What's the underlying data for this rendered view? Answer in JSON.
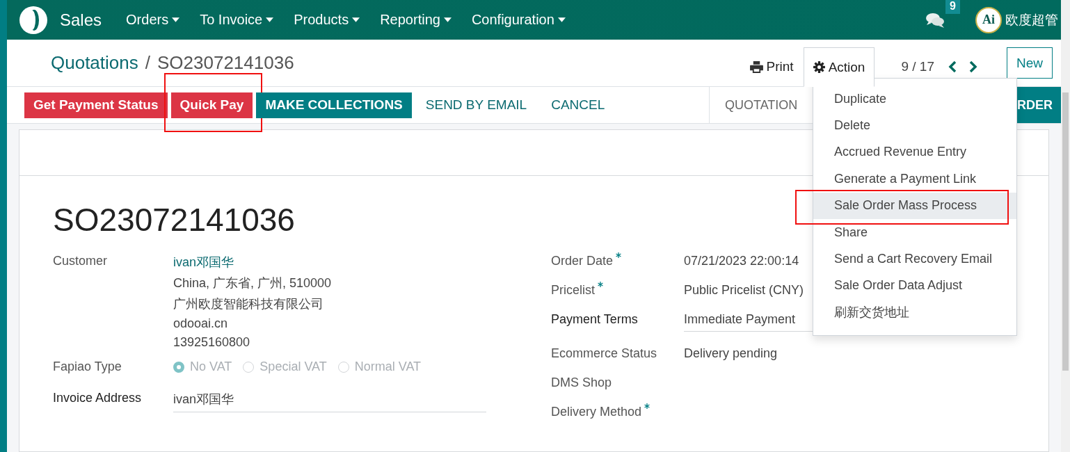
{
  "navbar": {
    "app": "Sales",
    "menus": [
      "Orders",
      "To Invoice",
      "Products",
      "Reporting",
      "Configuration"
    ],
    "messages_count": "9",
    "user": {
      "avatar_text": "Ai",
      "name": "欧度超管"
    }
  },
  "breadcrumb": {
    "parent": "Quotations",
    "separator": "/",
    "current": "SO23072141036"
  },
  "toolbar": {
    "print": "Print",
    "action": "Action",
    "action_open": true,
    "pager": "9 / 17",
    "new": "New"
  },
  "action_menu": [
    {
      "label": "Duplicate",
      "selected": false,
      "highlighted": false
    },
    {
      "label": "Delete",
      "selected": false,
      "highlighted": false
    },
    {
      "label": "Accrued Revenue Entry",
      "selected": false,
      "highlighted": false
    },
    {
      "label": "Generate a Payment Link",
      "selected": false,
      "highlighted": false
    },
    {
      "label": "Sale Order Mass Process",
      "selected": true,
      "highlighted": true
    },
    {
      "label": "Share",
      "selected": false,
      "highlighted": false
    },
    {
      "label": "Send a Cart Recovery Email",
      "selected": false,
      "highlighted": false
    },
    {
      "label": "Sale Order Data Adjust",
      "selected": false,
      "highlighted": false
    },
    {
      "label": "刷新交货地址",
      "selected": false,
      "highlighted": false
    }
  ],
  "buttons": [
    {
      "label": "Get Payment Status",
      "kind": "danger",
      "highlighted": false
    },
    {
      "label": "Quick Pay",
      "kind": "danger",
      "highlighted": true
    },
    {
      "label": "MAKE COLLECTIONS",
      "kind": "primary",
      "highlighted": false
    },
    {
      "label": "SEND BY EMAIL",
      "kind": "link",
      "highlighted": false
    },
    {
      "label": "CANCEL",
      "kind": "link",
      "highlighted": false
    }
  ],
  "statusbar": [
    {
      "label": "QUOTATION",
      "selected": false
    },
    {
      "label": "RDER",
      "selected": true
    }
  ],
  "form": {
    "title": "SO23072141036",
    "left": [
      {
        "label": "Customer",
        "kind": "partner",
        "value": "ivan邓国华",
        "lines": [
          "China, 广东省, 广州, 510000",
          "广州欧度智能科技有限公司",
          "odooai.cn",
          "13925160800"
        ]
      },
      {
        "label": "Fapiao Type",
        "kind": "radio",
        "options": [
          {
            "label": "No VAT",
            "selected": true
          },
          {
            "label": "Special VAT",
            "selected": false
          },
          {
            "label": "Normal VAT",
            "selected": false
          }
        ]
      },
      {
        "label": "Invoice Address",
        "kind": "input",
        "value": "ivan邓国华"
      }
    ],
    "right": [
      {
        "label": "Order Date",
        "kind": "text",
        "required": true,
        "value": "07/21/2023 22:00:14"
      },
      {
        "label": "Pricelist",
        "kind": "text",
        "required": true,
        "value": "Public Pricelist (CNY)"
      },
      {
        "label": "Payment Terms",
        "kind": "input",
        "required": false,
        "value": "Immediate Payment"
      },
      {
        "label": "Ecommerce Status",
        "kind": "text",
        "required": false,
        "value": "Delivery pending"
      },
      {
        "label": "DMS Shop",
        "kind": "text",
        "required": false
      },
      {
        "label": "Delivery Method",
        "kind": "text",
        "required": true
      }
    ]
  }
}
